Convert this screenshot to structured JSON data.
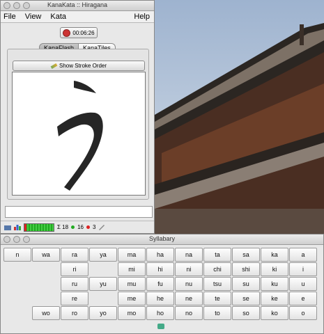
{
  "main_window": {
    "title": "KanaKata :: Hiragana",
    "menu": [
      "File",
      "View",
      "Kata"
    ],
    "help": "Help",
    "timer": "00:06:26",
    "tabs": [
      "KanaFlash",
      "KanaTiles"
    ],
    "stroke_button": "Show Stroke Order",
    "kana": "う",
    "answer_value": "",
    "status": {
      "sigma": "Σ 18",
      "green": "16",
      "red": "3"
    },
    "colors": {
      "accent_green": "#2a2",
      "accent_red": "#d22"
    }
  },
  "syllabary": {
    "title": "Syllabary",
    "rows": [
      [
        "n",
        "wa",
        "ra",
        "ya",
        "ma",
        "ha",
        "na",
        "ta",
        "sa",
        "ka",
        "a"
      ],
      [
        "",
        "",
        "ri",
        "",
        "mi",
        "hi",
        "ni",
        "chi",
        "shi",
        "ki",
        "i"
      ],
      [
        "",
        "",
        "ru",
        "yu",
        "mu",
        "fu",
        "nu",
        "tsu",
        "su",
        "ku",
        "u"
      ],
      [
        "",
        "",
        "re",
        "",
        "me",
        "he",
        "ne",
        "te",
        "se",
        "ke",
        "e"
      ],
      [
        "",
        "wo",
        "ro",
        "yo",
        "mo",
        "ho",
        "no",
        "to",
        "so",
        "ko",
        "o"
      ]
    ]
  }
}
